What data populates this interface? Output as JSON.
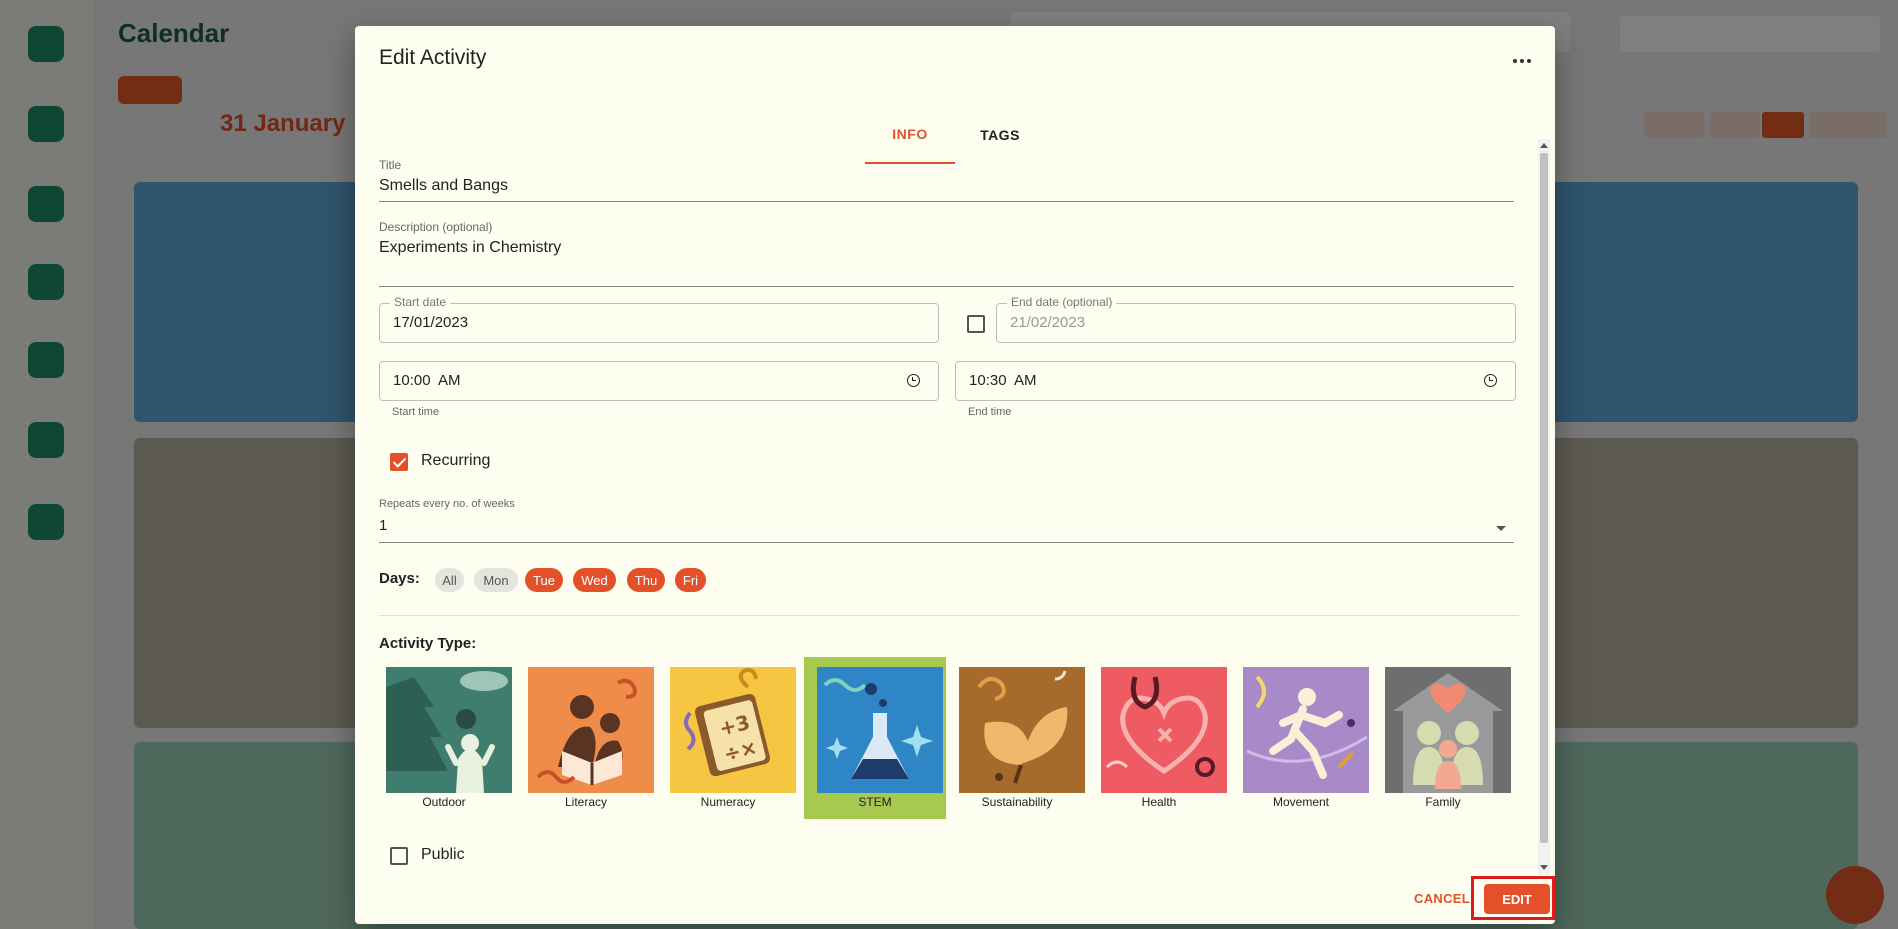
{
  "background": {
    "page_title": "Calendar",
    "date_heading": "31 January"
  },
  "dialog": {
    "title": "Edit Activity",
    "more_icon": "more-horizontal-icon",
    "tabs": [
      {
        "label": "INFO",
        "active": true
      },
      {
        "label": "TAGS",
        "active": false
      }
    ],
    "title_field": {
      "label": "Title",
      "value": "Smells and Bangs"
    },
    "description_field": {
      "label": "Description (optional)",
      "value": "Experiments in Chemistry"
    },
    "start_date": {
      "label": "Start date",
      "value": "17/01/2023"
    },
    "end_date": {
      "label": "End date (optional)",
      "value": "21/02/2023",
      "enabled": false
    },
    "start_time": {
      "value": "10:00  AM",
      "helper": "Start time",
      "icon": "clock-icon"
    },
    "end_time": {
      "value": "10:30  AM",
      "helper": "End time",
      "icon": "clock-icon"
    },
    "recurring": {
      "label": "Recurring",
      "checked": true
    },
    "repeats": {
      "label": "Repeats every no. of weeks",
      "value": "1"
    },
    "days": {
      "label": "Days:",
      "chips": [
        {
          "label": "All",
          "selected": false
        },
        {
          "label": "Mon",
          "selected": false
        },
        {
          "label": "Tue",
          "selected": true
        },
        {
          "label": "Wed",
          "selected": true
        },
        {
          "label": "Thu",
          "selected": true
        },
        {
          "label": "Fri",
          "selected": true
        }
      ]
    },
    "activity_type": {
      "label": "Activity Type:",
      "selected": "STEM",
      "types": [
        {
          "name": "Outdoor",
          "bg": "#3f7e6e"
        },
        {
          "name": "Literacy",
          "bg": "#ef8c4a"
        },
        {
          "name": "Numeracy",
          "bg": "#f6c643"
        },
        {
          "name": "STEM",
          "bg": "#2f86c6"
        },
        {
          "name": "Sustainability",
          "bg": "#a56a2c"
        },
        {
          "name": "Health",
          "bg": "#ee5b63"
        },
        {
          "name": "Movement",
          "bg": "#a88ac8"
        },
        {
          "name": "Family",
          "bg": "#6e6e70"
        }
      ]
    },
    "public": {
      "label": "Public",
      "checked": false
    },
    "actions": {
      "cancel": "CANCEL",
      "edit": "EDIT"
    }
  },
  "colors": {
    "accent": "#e3502a",
    "dialog_bg": "#fefef0",
    "selected_type": "#a8c94f",
    "highlight": "#e01b1b"
  }
}
